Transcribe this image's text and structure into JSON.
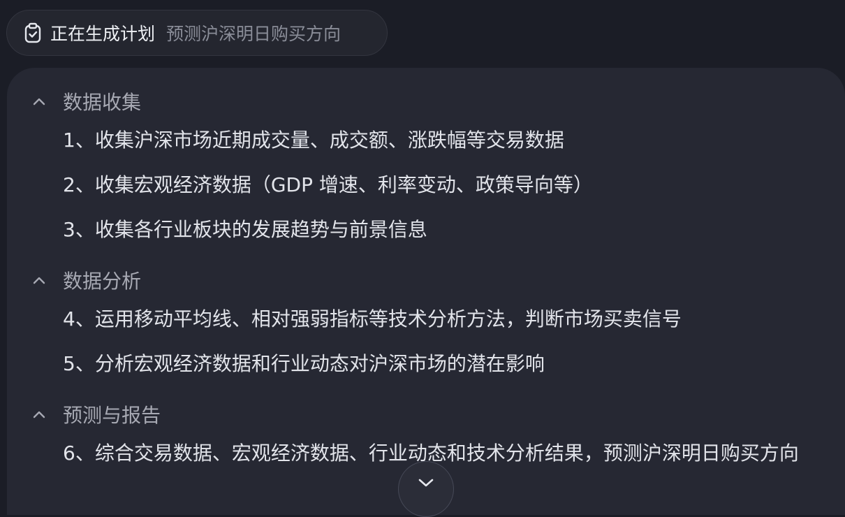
{
  "status": {
    "title": "正在生成计划",
    "subtitle": "预测沪深明日购买方向"
  },
  "sections": [
    {
      "label": "数据收集",
      "items": [
        "1、收集沪深市场近期成交量、成交额、涨跌幅等交易数据",
        "2、收集宏观经济数据（GDP 增速、利率变动、政策导向等）",
        "3、收集各行业板块的发展趋势与前景信息"
      ]
    },
    {
      "label": "数据分析",
      "items": [
        "4、运用移动平均线、相对强弱指标等技术分析方法，判断市场买卖信号",
        "5、分析宏观经济数据和行业动态对沪深市场的潜在影响"
      ]
    },
    {
      "label": "预测与报告",
      "items": [
        "6、综合交易数据、宏观经济数据、行业动态和技术分析结果，预测沪深明日购买方向"
      ]
    }
  ],
  "icons": {
    "status": "clipboard-check-icon",
    "collapse": "chevron-up-icon",
    "scroll": "chevron-down-icon"
  },
  "colors": {
    "background": "#1b1d26",
    "panel": "#262833",
    "text": "#e2e4ea",
    "muted": "#8a8d98"
  }
}
